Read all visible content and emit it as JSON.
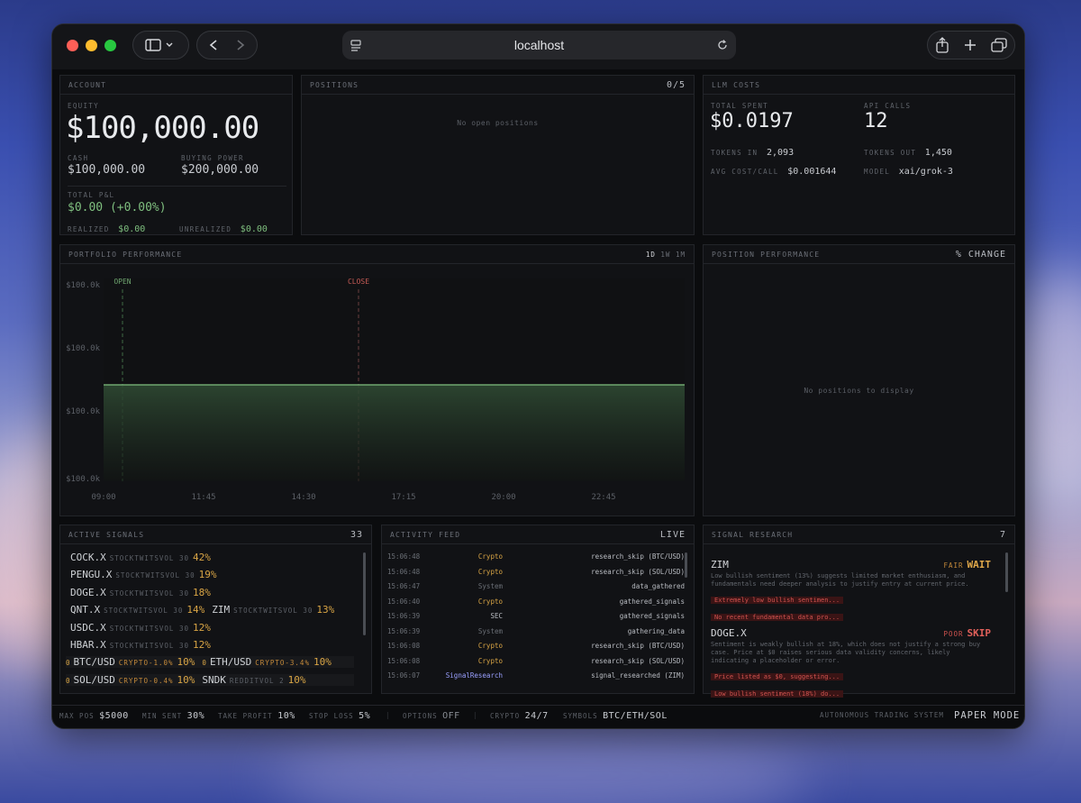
{
  "browser": {
    "url": "localhost"
  },
  "account": {
    "header": "ACCOUNT",
    "equity_label": "EQUITY",
    "equity": "$100,000.00",
    "cash_label": "CASH",
    "cash": "$100,000.00",
    "bp_label": "BUYING POWER",
    "buying_power": "$200,000.00",
    "pnl_label": "TOTAL P&L",
    "pnl": "$0.00 (+0.00%)",
    "realized_label": "REALIZED",
    "realized": "$0.00",
    "unrealized_label": "UNREALIZED",
    "unrealized": "$0.00"
  },
  "positions": {
    "header": "POSITIONS",
    "count": "0/5",
    "empty": "No open positions"
  },
  "llm": {
    "header": "LLM COSTS",
    "total_label": "TOTAL SPENT",
    "total": "$0.0197",
    "calls_label": "API CALLS",
    "calls": "12",
    "tin_label": "TOKENS IN",
    "tin": "2,093",
    "tout_label": "TOKENS OUT",
    "tout": "1,450",
    "avg_label": "AVG COST/CALL",
    "avg": "$0.001644",
    "model_label": "MODEL",
    "model": "xai/grok-3"
  },
  "portfolio": {
    "header": "PORTFOLIO PERFORMANCE",
    "ranges": [
      "1D",
      "1W",
      "1M"
    ],
    "open_label": "OPEN",
    "close_label": "CLOSE"
  },
  "chart_data": {
    "type": "area",
    "title": "PORTFOLIO PERFORMANCE",
    "x": [
      "09:00",
      "11:45",
      "14:30",
      "17:15",
      "20:00",
      "22:45"
    ],
    "y_ticks": [
      "$100.0k",
      "$100.0k",
      "$100.0k",
      "$100.0k"
    ],
    "series": [
      {
        "values": [
          100000,
          100000,
          100000,
          100000,
          100000,
          100000
        ]
      }
    ],
    "color": "#7fbf7f"
  },
  "position_perf": {
    "header": "POSITION PERFORMANCE",
    "right": "% CHANGE",
    "empty": "No positions to display"
  },
  "signals": {
    "header": "ACTIVE SIGNALS",
    "count": "33",
    "rows": [
      [
        {
          "sym": "COCK.X",
          "src": "STOCKTWITSVOL 30",
          "pct": "42%"
        }
      ],
      [
        {
          "sym": "PENGU.X",
          "src": "STOCKTWITSVOL 30",
          "pct": "19%"
        }
      ],
      [
        {
          "sym": "DOGE.X",
          "src": "STOCKTWITSVOL 30",
          "pct": "18%"
        }
      ],
      [
        {
          "sym": "QNT.X",
          "src": "STOCKTWITSVOL 30",
          "pct": "14%"
        },
        {
          "sym": "ZIM",
          "src": "STOCKTWITSVOL 30",
          "pct": "13%"
        }
      ],
      [
        {
          "sym": "USDC.X",
          "src": "STOCKTWITSVOL 30",
          "pct": "12%"
        }
      ],
      [
        {
          "sym": "HBAR.X",
          "src": "STOCKTWITSVOL 30",
          "pct": "12%"
        }
      ],
      [
        {
          "pre": "0",
          "sym": "BTC/USD",
          "src": "CRYPTO-1.0%",
          "pct": "10%"
        },
        {
          "pre": "0",
          "sym": "ETH/USD",
          "src": "CRYPTO-3.4%",
          "pct": "10%"
        }
      ],
      [
        {
          "pre": "0",
          "sym": "SOL/USD",
          "src": "CRYPTO-0.4%",
          "pct": "10%"
        },
        {
          "sym": "SNDK",
          "src": "REDDITVOL 2",
          "pct": "10%"
        }
      ]
    ]
  },
  "feed": {
    "header": "ACTIVITY FEED",
    "status": "LIVE",
    "rows": [
      {
        "t": "15:06:48",
        "src": "Crypto",
        "ev": "research_skip (BTC/USD)"
      },
      {
        "t": "15:06:48",
        "src": "Crypto",
        "ev": "research_skip (SOL/USD)"
      },
      {
        "t": "15:06:47",
        "src": "System",
        "ev": "data_gathered"
      },
      {
        "t": "15:06:40",
        "src": "Crypto",
        "ev": "gathered_signals"
      },
      {
        "t": "15:06:39",
        "src": "SEC",
        "ev": "gathered_signals"
      },
      {
        "t": "15:06:39",
        "src": "System",
        "ev": "gathering_data"
      },
      {
        "t": "15:06:08",
        "src": "Crypto",
        "ev": "research_skip (BTC/USD)"
      },
      {
        "t": "15:06:08",
        "src": "Crypto",
        "ev": "research_skip (SOL/USD)"
      },
      {
        "t": "15:06:07",
        "src": "SignalResearch",
        "ev": "signal_researched (ZIM)"
      }
    ]
  },
  "research": {
    "header": "SIGNAL RESEARCH",
    "count": "7",
    "items": [
      {
        "sym": "ZIM",
        "quality": "FAIR",
        "verdict": "WAIT",
        "text": "Low bullish sentiment (13%) suggests limited market enthusiasm, and fundamentals need deeper analysis to justify entry at current price.",
        "tags": [
          "Extremely low bullish sentimen...",
          "No recent fundamental data pro..."
        ]
      },
      {
        "sym": "DOGE.X",
        "quality": "POOR",
        "verdict": "SKIP",
        "text": "Sentiment is weakly bullish at 18%, which does not justify a strong buy case. Price at $0 raises serious data validity concerns, likely indicating a placeholder or error.",
        "tags": [
          "Price listed as $0, suggesting...",
          "Low bullish sentiment (18%) do..."
        ]
      }
    ]
  },
  "footer": {
    "maxpos_label": "MAX POS",
    "maxpos": "$5000",
    "minsent_label": "MIN SENT",
    "minsent": "30%",
    "tp_label": "TAKE PROFIT",
    "tp": "10%",
    "sl_label": "STOP LOSS",
    "sl": "5%",
    "options_label": "OPTIONS",
    "options": "OFF",
    "crypto_label": "CRYPTO",
    "crypto": "24/7",
    "symbols_label": "SYMBOLS",
    "symbols": "BTC/ETH/SOL",
    "system": "AUTONOMOUS TRADING SYSTEM",
    "mode": "PAPER MODE"
  }
}
